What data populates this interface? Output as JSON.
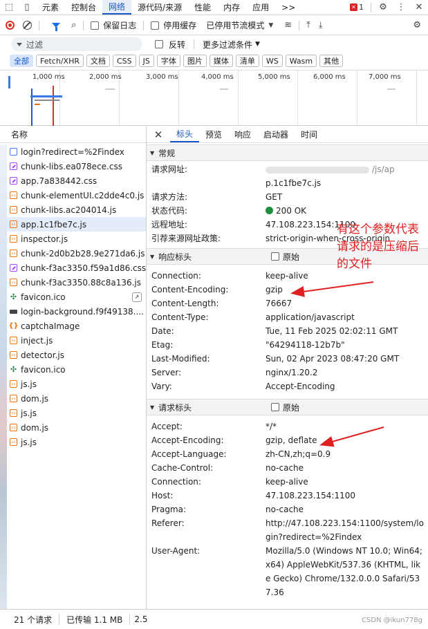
{
  "topbar": {
    "tabs": [
      {
        "label": "元素",
        "active": false
      },
      {
        "label": "控制台",
        "active": false
      },
      {
        "label": "网络",
        "active": true
      },
      {
        "label": "源代码/来源",
        "active": false
      },
      {
        "label": "性能",
        "active": false
      },
      {
        "label": "内存",
        "active": false
      },
      {
        "label": "应用",
        "active": false
      }
    ],
    "more_label": ">>",
    "error_count": "1"
  },
  "toolbar": {
    "preserve_log": "保留日志",
    "disable_cache": "停用缓存",
    "throttle": "已停用节流模式"
  },
  "filter": {
    "placeholder": "过滤",
    "invert": "反转",
    "more_filters": "更多过滤条件"
  },
  "type_filters": [
    "全部",
    "Fetch/XHR",
    "文档",
    "CSS",
    "JS",
    "字体",
    "图片",
    "媒体",
    "清单",
    "WS",
    "Wasm",
    "其他"
  ],
  "timeline": {
    "ticks": [
      "1,000 ms",
      "2,000 ms",
      "3,000 ms",
      "4,000 ms",
      "5,000 ms",
      "6,000 ms",
      "7,000 ms"
    ]
  },
  "requests": {
    "header": "名称",
    "items": [
      {
        "name": "login?redirect=%2Findex",
        "type": "doc"
      },
      {
        "name": "chunk-libs.ea078ece.css",
        "type": "css"
      },
      {
        "name": "app.7a838442.css",
        "type": "css"
      },
      {
        "name": "chunk-elementUI.c2dde4c0.js",
        "type": "js"
      },
      {
        "name": "chunk-libs.ac204014.js",
        "type": "js"
      },
      {
        "name": "app.1c1fbe7c.js",
        "type": "js",
        "selected": true
      },
      {
        "name": "inspector.js",
        "type": "js"
      },
      {
        "name": "chunk-2d0b2b28.9e271da6.js",
        "type": "js"
      },
      {
        "name": "chunk-f3ac3350.f59a1d86.css",
        "type": "css"
      },
      {
        "name": "chunk-f3ac3350.88c8a136.js",
        "type": "js"
      },
      {
        "name": "favicon.ico",
        "type": "fav",
        "overlay": true
      },
      {
        "name": "login-background.f9f49138....",
        "type": "img"
      },
      {
        "name": "captchaImage",
        "type": "xhr"
      },
      {
        "name": "inject.js",
        "type": "js"
      },
      {
        "name": "detector.js",
        "type": "js"
      },
      {
        "name": "favicon.ico",
        "type": "fav"
      },
      {
        "name": "js.js",
        "type": "js"
      },
      {
        "name": "dom.js",
        "type": "js"
      },
      {
        "name": "js.js",
        "type": "js"
      },
      {
        "name": "dom.js",
        "type": "js"
      },
      {
        "name": "js.js",
        "type": "js"
      }
    ]
  },
  "detail_tabs": [
    {
      "label": "标头",
      "active": true
    },
    {
      "label": "预览",
      "active": false
    },
    {
      "label": "响应",
      "active": false
    },
    {
      "label": "启动器",
      "active": false
    },
    {
      "label": "时间",
      "active": false
    }
  ],
  "general": {
    "title": "常规",
    "rows": [
      {
        "k": "请求网址:",
        "v": "p.1c1fbe7c.js",
        "blurred_prefix": "/js/ap"
      },
      {
        "k": "请求方法:",
        "v": "GET"
      },
      {
        "k": "状态代码:",
        "v": "200 OK",
        "status": true
      },
      {
        "k": "远程地址:",
        "v": "47.108.223.154:1100"
      },
      {
        "k": "引荐来源网址政策:",
        "v": "strict-origin-when-cross-origin"
      }
    ]
  },
  "response_headers": {
    "title": "响应标头",
    "raw_label": "原始",
    "rows": [
      {
        "k": "Connection:",
        "v": "keep-alive"
      },
      {
        "k": "Content-Encoding:",
        "v": "gzip"
      },
      {
        "k": "Content-Length:",
        "v": "76667"
      },
      {
        "k": "Content-Type:",
        "v": "application/javascript"
      },
      {
        "k": "Date:",
        "v": "Tue, 11 Feb 2025 02:02:11 GMT"
      },
      {
        "k": "Etag:",
        "v": "\"64294118-12b7b\""
      },
      {
        "k": "Last-Modified:",
        "v": "Sun, 02 Apr 2023 08:47:20 GMT"
      },
      {
        "k": "Server:",
        "v": "nginx/1.20.2"
      },
      {
        "k": "Vary:",
        "v": "Accept-Encoding"
      }
    ]
  },
  "request_headers": {
    "title": "请求标头",
    "raw_label": "原始",
    "rows": [
      {
        "k": "Accept:",
        "v": "*/*"
      },
      {
        "k": "Accept-Encoding:",
        "v": "gzip, deflate"
      },
      {
        "k": "Accept-Language:",
        "v": "zh-CN,zh;q=0.9"
      },
      {
        "k": "Cache-Control:",
        "v": "no-cache"
      },
      {
        "k": "Connection:",
        "v": "keep-alive"
      },
      {
        "k": "Host:",
        "v": "47.108.223.154:1100"
      },
      {
        "k": "Pragma:",
        "v": "no-cache"
      },
      {
        "k": "Referer:",
        "v": "http://47.108.223.154:1100/system/login?redirect=%2Findex"
      },
      {
        "k": "User-Agent:",
        "v": "Mozilla/5.0 (Windows NT 10.0; Win64; x64) AppleWebKit/537.36 (KHTML, like Gecko) Chrome/132.0.0.0 Safari/537.36"
      }
    ]
  },
  "status": {
    "requests": "21 个请求",
    "transferred": "已传输 1.1 MB",
    "resources": "2.5"
  },
  "annotation": "有这个参数代表请求的是压缩后的文件",
  "watermark": "CSDN @ikun778g",
  "colors": {
    "accent": "#1a56c4",
    "annotation": "#e02020",
    "status_ok": "#1e8e3e"
  }
}
